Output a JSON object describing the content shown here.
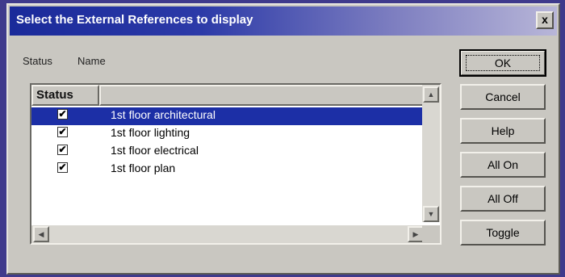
{
  "window": {
    "title": "Select the External References to display",
    "close_glyph": "x"
  },
  "column_labels": {
    "status": "Status",
    "name": "Name"
  },
  "list": {
    "header_status": "Status",
    "header_name": "",
    "rows": [
      {
        "checked": true,
        "name": "1st floor architectural",
        "selected": true
      },
      {
        "checked": true,
        "name": "1st floor lighting",
        "selected": false
      },
      {
        "checked": true,
        "name": "1st floor electrical",
        "selected": false
      },
      {
        "checked": true,
        "name": "1st floor plan",
        "selected": false
      }
    ]
  },
  "buttons": {
    "ok": "OK",
    "cancel": "Cancel",
    "help": "Help",
    "all_on": "All On",
    "all_off": "All Off",
    "toggle": "Toggle"
  },
  "icons": {
    "check": "check-icon",
    "up_arrow": "scroll-up-icon",
    "down_arrow": "scroll-down-icon",
    "left_arrow": "scroll-left-icon",
    "right_arrow": "scroll-right-icon"
  },
  "colors": {
    "selection": "#1c2fa6",
    "dialog_face": "#c9c7c1"
  }
}
